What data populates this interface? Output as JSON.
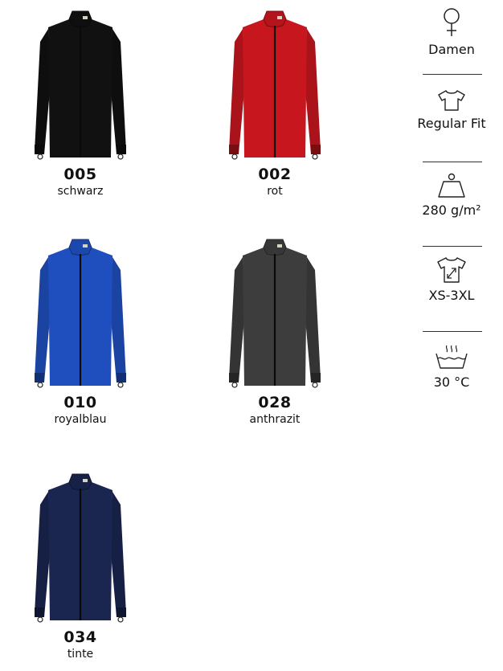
{
  "products": [
    {
      "code": "005",
      "name": "schwarz",
      "color": "#111111"
    },
    {
      "code": "002",
      "name": "rot",
      "color": "#c8161e"
    },
    {
      "code": "010",
      "name": "royalblau",
      "color": "#1f4fbf"
    },
    {
      "code": "028",
      "name": "anthrazit",
      "color": "#3d3d3d"
    },
    {
      "code": "034",
      "name": "tinte",
      "color": "#1a2550"
    }
  ],
  "features": [
    {
      "icon": "female-symbol-icon",
      "label": "Damen"
    },
    {
      "icon": "tshirt-icon",
      "label": "Regular Fit"
    },
    {
      "icon": "weight-icon",
      "label": "280 g/m²"
    },
    {
      "icon": "size-range-icon",
      "label": "XS-3XL"
    },
    {
      "icon": "wash-30-icon",
      "label": "30 °C"
    }
  ]
}
